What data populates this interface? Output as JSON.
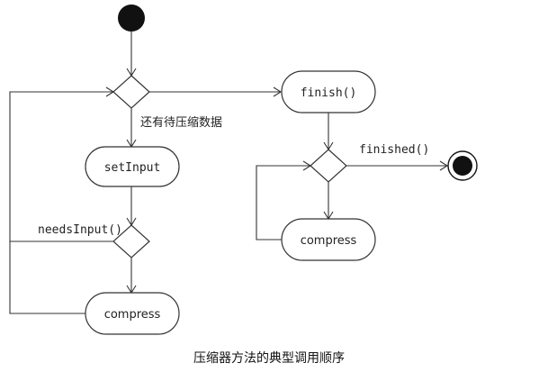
{
  "nodes": {
    "set_input": "setInput",
    "compress_left": "compress",
    "finish": "finish()",
    "compress_right": "compress"
  },
  "edge_labels": {
    "has_data": "还有待压缩数据",
    "needs_input": "needsInput()",
    "finished": "finished()"
  },
  "caption": "压缩器方法的典型调用顺序"
}
